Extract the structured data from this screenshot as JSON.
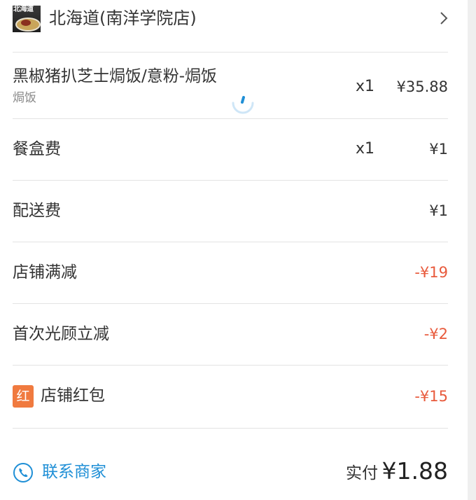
{
  "shop": {
    "logo_text": "北海道",
    "name": "北海道(南洋学院店)",
    "chevron_icon": "chevron-right-icon"
  },
  "item": {
    "name": "黑椒猪扒芝士焗饭/意粉-焗饭",
    "category": "焗饭",
    "quantity": "x1",
    "price": "¥35.88",
    "loading_icon": "loading-spinner-icon"
  },
  "fees": [
    {
      "label": "餐盒费",
      "quantity": "x1",
      "price": "¥1"
    },
    {
      "label": "配送费",
      "price": "¥1"
    }
  ],
  "discounts": [
    {
      "label": "店铺满减",
      "amount": "-¥19"
    },
    {
      "label": "首次光顾立减",
      "amount": "-¥2"
    },
    {
      "badge": "红",
      "label": "店铺红包",
      "amount": "-¥15"
    }
  ],
  "footer": {
    "contact_label": "联系商家",
    "contact_icon": "phone-icon",
    "paid_label": "实付",
    "paid_amount": "¥1.88"
  },
  "colors": {
    "discount": "#e85a3c",
    "link": "#1f8fd6",
    "badge": "#f07a3f"
  }
}
